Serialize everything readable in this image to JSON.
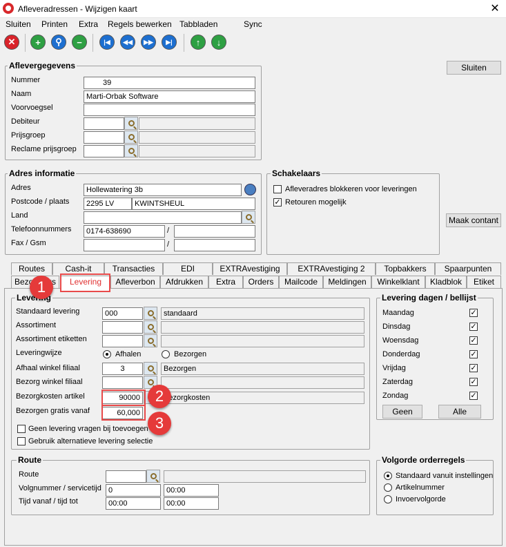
{
  "window": {
    "title": "Afleveradressen - Wijzigen kaart"
  },
  "menu": [
    "Sluiten",
    "Printen",
    "Extra",
    "Regels bewerken",
    "Tabbladen",
    "Sync"
  ],
  "close_button": "Sluiten",
  "aflevergegevens": {
    "title": "Aflevergegevens",
    "nummer_label": "Nummer",
    "nummer": "39",
    "naam_label": "Naam",
    "naam": "Marti-Orbak Software",
    "voorvoegsel_label": "Voorvoegsel",
    "debiteur_label": "Debiteur",
    "prijsgroep_label": "Prijsgroep",
    "reclame_label": "Reclame prijsgroep"
  },
  "adres": {
    "title": "Adres informatie",
    "adres_label": "Adres",
    "adres": "Hollewatering 3b",
    "postcode_label": "Postcode / plaats",
    "postcode": "2295 LV",
    "plaats": "KWINTSHEUL",
    "land_label": "Land",
    "telefoon_label": "Telefoonnummers",
    "telefoon": "0174-638690",
    "fax_label": "Fax / Gsm",
    "slash": "/"
  },
  "schakelaars": {
    "title": "Schakelaars",
    "blokkeren": "Afleveradres blokkeren voor leveringen",
    "retouren": "Retouren mogelijk"
  },
  "maak_contant": "Maak contant",
  "tabs_row1": [
    "Routes",
    "Cash-it",
    "Transacties",
    "EDI",
    "EXTRAvestiging",
    "EXTRAvestiging 2",
    "Topbakkers",
    "Spaarpunten"
  ],
  "tabs_row2": [
    "Bezorgings",
    "Levering",
    "Afleverbon",
    "Afdrukken",
    "Extra",
    "Orders",
    "Mailcode",
    "Meldingen",
    "Winkelklant",
    "Kladblok",
    "Etiket"
  ],
  "levering": {
    "title": "Levering",
    "standaard_label": "Standaard levering",
    "standaard_code": "000",
    "standaard_desc": "standaard",
    "assortiment_label": "Assortiment",
    "assortiment_etiketten_label": "Assortiment etiketten",
    "leveringwijze_label": "Leveringwijze",
    "afhalen": "Afhalen",
    "bezorgen": "Bezorgen",
    "afhaal_label": "Afhaal winkel filiaal",
    "afhaal_code": "3",
    "afhaal_desc": "Bezorgen",
    "bezorg_label": "Bezorg winkel filiaal",
    "kosten_label": "Bezorgkosten artikel",
    "kosten_code": "90000",
    "kosten_desc": "Bezorgkosten",
    "gratis_label": "Bezorgen gratis vanaf",
    "gratis_value": "60,000",
    "geen_levering": "Geen levering vragen bij toevoegen order",
    "alternatieve": "Gebruik alternatieve levering selectie"
  },
  "dagen": {
    "title": "Levering dagen / bellijst",
    "days": [
      "Maandag",
      "Dinsdag",
      "Woensdag",
      "Donderdag",
      "Vrijdag",
      "Zaterdag",
      "Zondag"
    ],
    "geen": "Geen",
    "alle": "Alle"
  },
  "route": {
    "title": "Route",
    "route_label": "Route",
    "volgnummer_label": "Volgnummer / servicetijd",
    "volgnummer": "0",
    "servicetijd": "00:00",
    "tijd_label": "Tijd vanaf / tijd tot",
    "tijd_vanaf": "00:00",
    "tijd_tot": "00:00"
  },
  "volgorde": {
    "title": "Volgorde orderregels",
    "opt1": "Standaard vanuit instellingen",
    "opt2": "Artikelnummer",
    "opt3": "Invoervolgorde"
  },
  "badges": [
    "1",
    "2",
    "3"
  ],
  "colors": {
    "accent_red": "#e53a3a",
    "active_tab_text": "#e03030"
  }
}
